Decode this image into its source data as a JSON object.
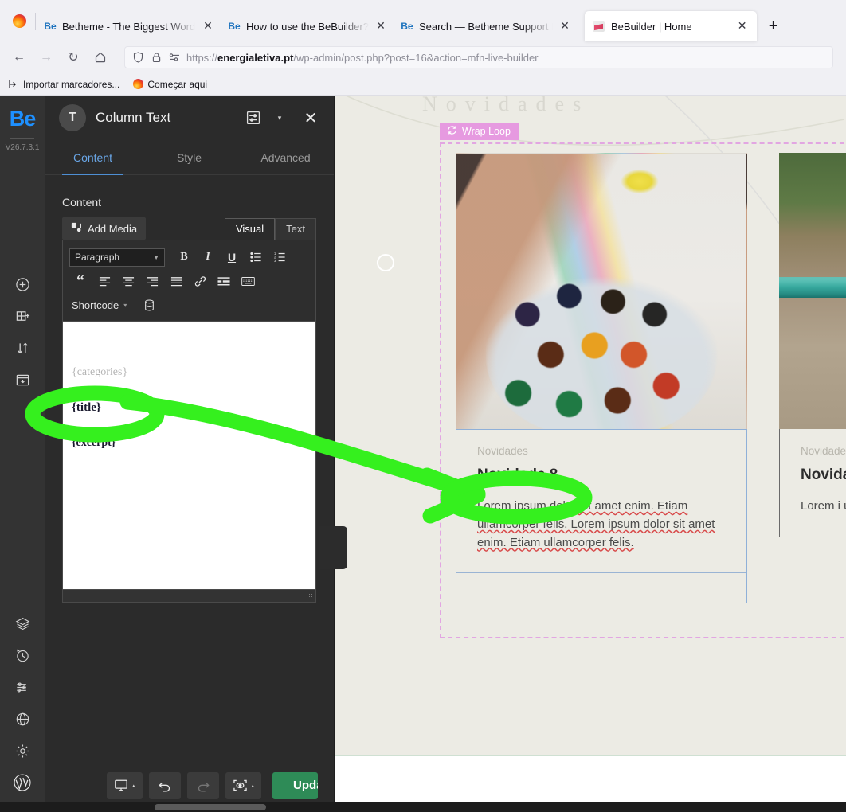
{
  "browser": {
    "tabs": [
      {
        "title": "Betheme - The Biggest WordPre",
        "favicon": "be-icon",
        "active": false
      },
      {
        "title": "How to use the BeBuilder?",
        "favicon": "be-icon",
        "active": false
      },
      {
        "title": "Search — Betheme Support For",
        "favicon": "be-icon",
        "active": false
      },
      {
        "title": "BeBuilder | Home",
        "favicon": "site-icon",
        "active": true
      }
    ],
    "new_tab_label": "+",
    "close_label": "✕",
    "nav": {
      "back": "←",
      "forward": "→",
      "reload": "↻",
      "home": "⌂"
    },
    "url": {
      "scheme": "https://",
      "domain": "energialetiva.pt",
      "path": "/wp-admin/post.php?post=16&action=mfn-live-builder",
      "full": "https://energialetiva.pt/wp-admin/post.php?post=16&action=mfn-live-builder"
    },
    "bookmarks": [
      {
        "label": "Importar marcadores...",
        "icon": "import-icon"
      },
      {
        "label": "Começar aqui",
        "icon": "firefox-icon"
      }
    ]
  },
  "rail": {
    "logo": "Be",
    "version": "V26.7.3.1",
    "items": [
      {
        "icon": "plus-circle-icon",
        "glyph": "⊕"
      },
      {
        "icon": "add-section-icon",
        "glyph": "⊞"
      },
      {
        "icon": "sort-arrows-icon",
        "glyph": "⇅"
      },
      {
        "icon": "template-icon",
        "glyph": "▣"
      }
    ],
    "bottom_items": [
      {
        "icon": "layers-icon"
      },
      {
        "icon": "history-icon"
      },
      {
        "icon": "sliders-icon"
      },
      {
        "icon": "globe-icon"
      },
      {
        "icon": "gear-icon"
      }
    ],
    "wp_icon": "wordpress-icon"
  },
  "panel": {
    "avatar_letter": "T",
    "title": "Column Text",
    "header_icons": [
      {
        "name": "panel-layout-icon"
      },
      {
        "name": "chevron-down-icon",
        "glyph": "▾"
      },
      {
        "name": "close-icon",
        "glyph": "✕"
      }
    ],
    "tabs": [
      {
        "label": "Content",
        "active": true
      },
      {
        "label": "Style",
        "active": false
      },
      {
        "label": "Advanced",
        "active": false
      }
    ],
    "section_label": "Content",
    "add_media_label": "Add Media",
    "editor_tabs": [
      {
        "label": "Visual",
        "selected": true
      },
      {
        "label": "Text",
        "selected": false
      }
    ],
    "toolbar": {
      "format_select": "Paragraph",
      "buttons_row1": [
        {
          "name": "bold-icon",
          "glyph": "B"
        },
        {
          "name": "italic-icon",
          "glyph": "I"
        },
        {
          "name": "underline-icon",
          "glyph": "U"
        },
        {
          "name": "bulleted-list-icon",
          "glyph": "☰"
        },
        {
          "name": "numbered-list-icon",
          "glyph": "≡"
        }
      ],
      "buttons_row2": [
        {
          "name": "blockquote-icon",
          "glyph": "“"
        },
        {
          "name": "align-left-icon",
          "glyph": "≡"
        },
        {
          "name": "align-center-icon",
          "glyph": "≡"
        },
        {
          "name": "align-right-icon",
          "glyph": "≡"
        },
        {
          "name": "align-justify-icon",
          "glyph": "≡"
        },
        {
          "name": "insert-link-icon",
          "glyph": "🔗"
        },
        {
          "name": "read-more-icon",
          "glyph": "—"
        },
        {
          "name": "keyboard-shortcuts-icon",
          "glyph": "⌨"
        }
      ],
      "shortcode_label": "Shortcode",
      "shortcode_caret": "▾",
      "database_icon": "database-icon"
    },
    "editor_content": {
      "categories": "{categories}",
      "title": "{title}",
      "excerpt": "{excerpt}"
    },
    "footer": {
      "responsive_icon": "monitor-icon",
      "responsive_caret": "▴",
      "undo_icon": "undo-icon",
      "redo_icon": "redo-icon",
      "preview_icon": "preview-eye-icon",
      "preview_caret": "▴",
      "update_label": "Update",
      "update_caret": "▴"
    }
  },
  "preview": {
    "faint_heading": "Novidades",
    "wrap_loop_badge": {
      "label": "Wrap Loop",
      "icon": "loop-icon",
      "color": "#e69ae0"
    },
    "cards": [
      {
        "kicker": "Novidades",
        "heading": "Novidade 8",
        "paragraph": "Lorem ipsum dolor sit amet enim. Etiam ullamcorper felis. Lorem ipsum dolor sit amet enim. Etiam ullamcorper felis.",
        "image": "crayons-photo",
        "selected": true
      },
      {
        "kicker": "Novidades",
        "heading": "Novidade",
        "paragraph": "Lorem i ullamco amet en",
        "image": "children-outdoor-photo",
        "selected": false
      }
    ]
  },
  "annotation": {
    "color": "#35f01e",
    "description": "green-marker-arrow-from-title-token-to-novidade-8-heading"
  },
  "colors": {
    "accent_blue": "#1E90FF",
    "update_green": "#2e8b57",
    "canvas_bg": "#ecebe4",
    "panel_bg": "#2b2b2b",
    "loop_pink": "#e2a6e2",
    "annotation_green": "#35f01e"
  }
}
